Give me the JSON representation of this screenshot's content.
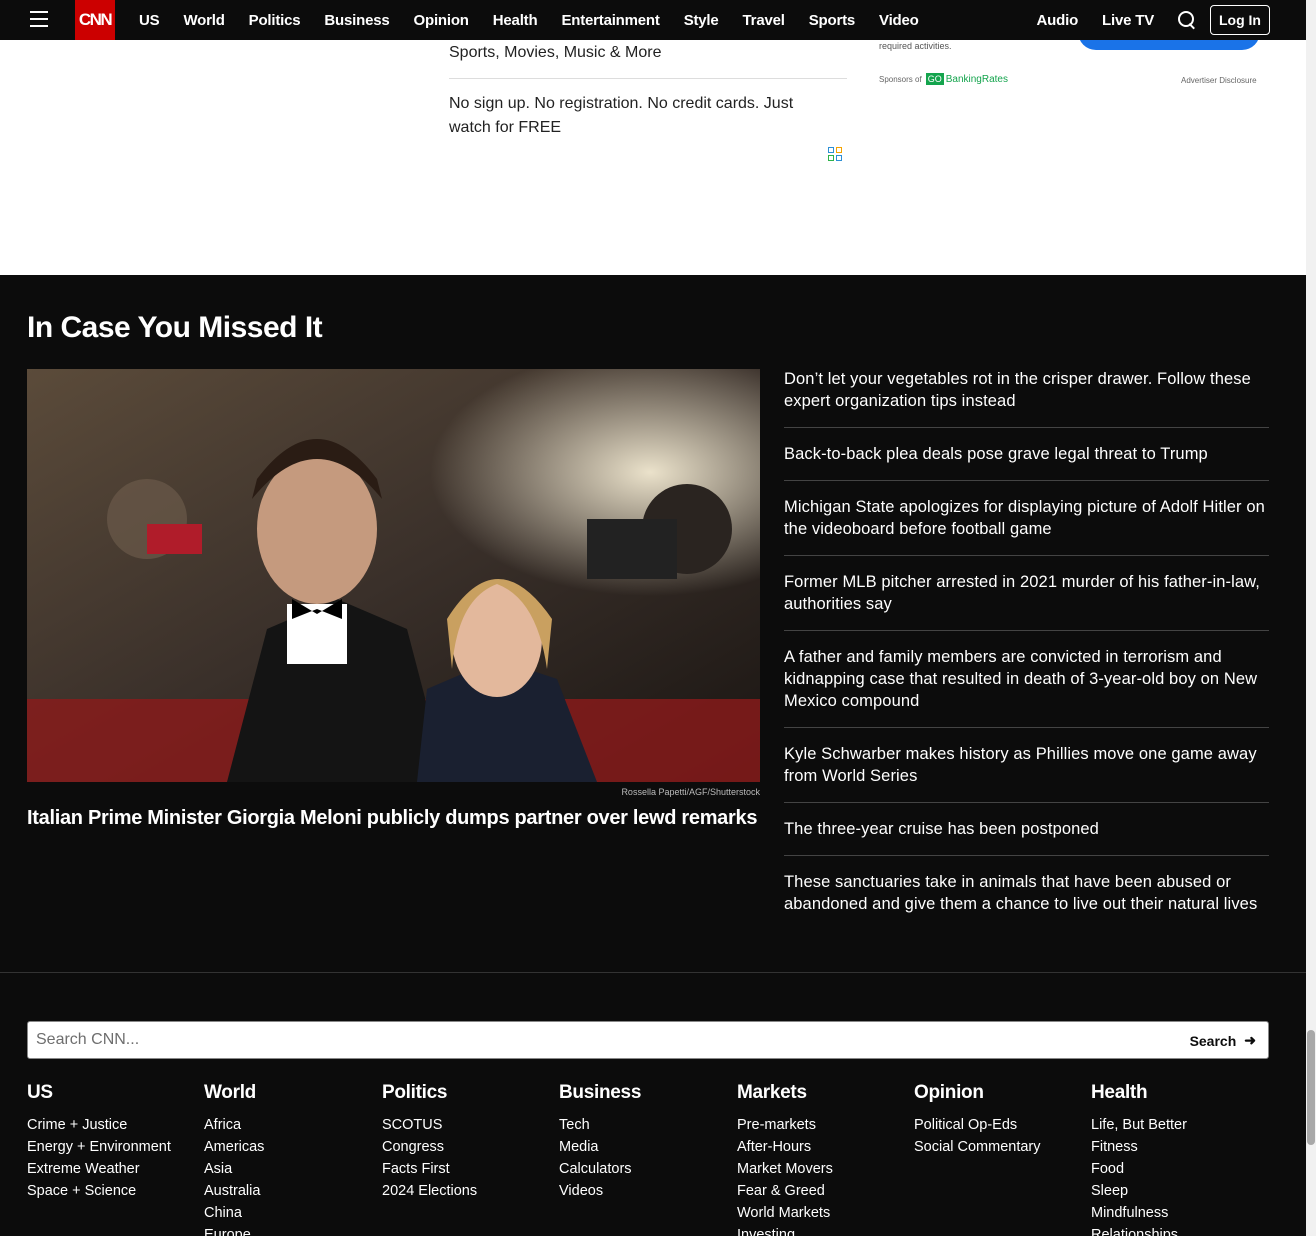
{
  "nav": {
    "logo": "CNN",
    "links": [
      "US",
      "World",
      "Politics",
      "Business",
      "Opinion",
      "Health",
      "Entertainment",
      "Style",
      "Travel",
      "Sports",
      "Video"
    ],
    "right_links": [
      "Audio",
      "Live TV"
    ],
    "login_label": "Log In"
  },
  "ad": {
    "line1": "Sports, Movies, Music & More",
    "line2": "No sign up. No registration. No credit cards. Just watch for FREE",
    "required_activities": "required activities.",
    "sponsor_prefix": "Sponsors of",
    "sponsor_go": "GO",
    "sponsor_name": "BankingRates",
    "disclosure": "Advertiser Disclosure"
  },
  "icymi": {
    "title": "In Case You Missed It",
    "hero": {
      "credit": "Rossella Papetti/AGF/Shutterstock",
      "headline": "Italian Prime Minister Giorgia Meloni publicly dumps partner over lewd remarks"
    },
    "stories": [
      "Don’t let your vegetables rot in the crisper drawer. Follow these expert organization tips instead",
      "Back-to-back plea deals pose grave legal threat to Trump",
      "Michigan State apologizes for displaying picture of Adolf Hitler on the videoboard before football game",
      "Former MLB pitcher arrested in 2021 murder of his father-in-law, authorities say",
      "A father and family members are convicted in terrorism and kidnapping case that resulted in death of 3-year-old boy on New Mexico compound",
      "Kyle Schwarber makes history as Phillies move one game away from World Series",
      "The three-year cruise has been postponed",
      "These sanctuaries take in animals that have been abused or abandoned and give them a chance to live out their natural lives"
    ]
  },
  "footer": {
    "search_placeholder": "Search CNN...",
    "search_button": "Search",
    "columns": [
      {
        "title": "US",
        "links": [
          "Crime + Justice",
          "Energy + Environment",
          "Extreme Weather",
          "Space + Science"
        ]
      },
      {
        "title": "World",
        "links": [
          "Africa",
          "Americas",
          "Asia",
          "Australia",
          "China",
          "Europe"
        ]
      },
      {
        "title": "Politics",
        "links": [
          "SCOTUS",
          "Congress",
          "Facts First",
          "2024 Elections"
        ]
      },
      {
        "title": "Business",
        "links": [
          "Tech",
          "Media",
          "Calculators",
          "Videos"
        ]
      },
      {
        "title": "Markets",
        "links": [
          "Pre-markets",
          "After-Hours",
          "Market Movers",
          "Fear & Greed",
          "World Markets",
          "Investing"
        ]
      },
      {
        "title": "Opinion",
        "links": [
          "Political Op-Eds",
          "Social Commentary"
        ]
      },
      {
        "title": "Health",
        "links": [
          "Life, But Better",
          "Fitness",
          "Food",
          "Sleep",
          "Mindfulness",
          "Relationships"
        ]
      }
    ]
  }
}
